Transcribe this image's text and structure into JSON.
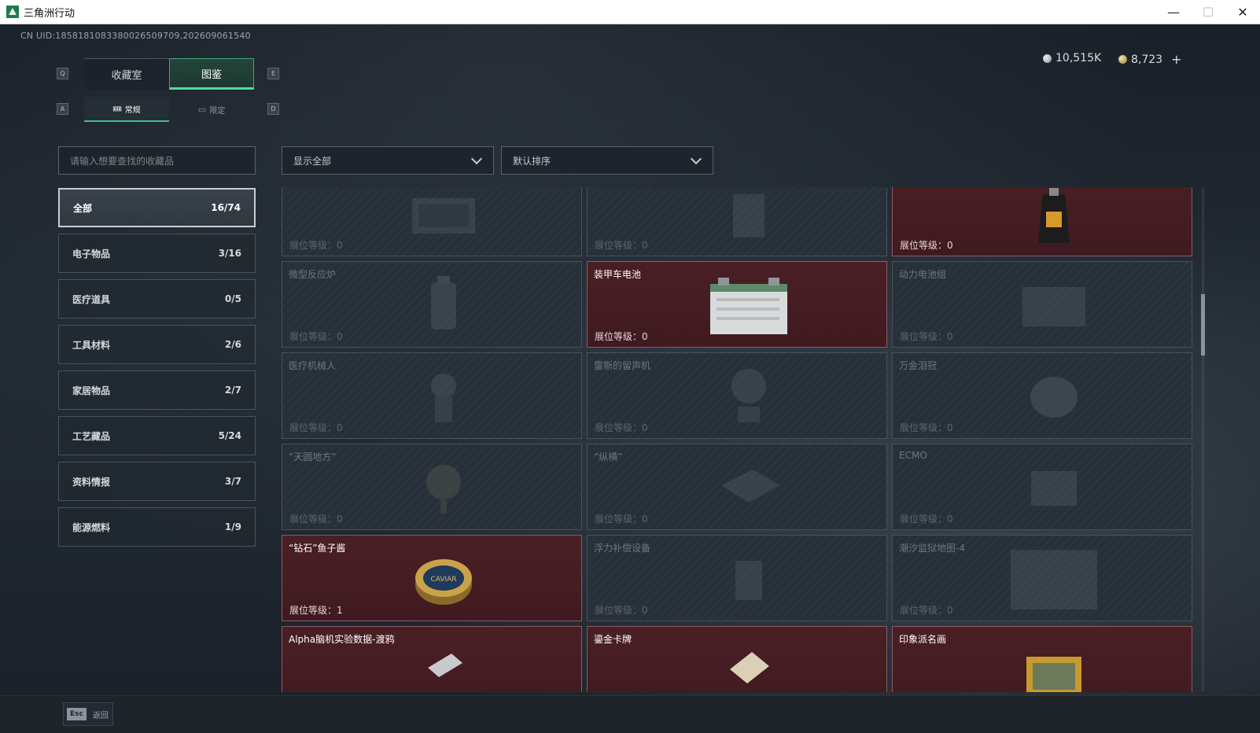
{
  "window": {
    "title": "三角洲行动",
    "minimize": "—",
    "maximize": "☐",
    "close": "✕"
  },
  "uid": "CN UID:1858181083380026509709,202609061540",
  "keys": {
    "q": "Q",
    "e": "E",
    "a": "A",
    "d": "D",
    "esc": "Esc"
  },
  "tabs": [
    {
      "label": "收藏室"
    },
    {
      "label": "图鉴"
    }
  ],
  "subtabs": [
    {
      "label": "常规",
      "icon": "🝚"
    },
    {
      "label": "限定",
      "icon": "▭"
    }
  ],
  "currency": {
    "silver": "10,515K",
    "gold": "8,723",
    "add": "+"
  },
  "search": {
    "placeholder": "请输入想要查找的收藏品"
  },
  "categories": [
    {
      "name": "全部",
      "count": "16/74",
      "active": true
    },
    {
      "name": "电子物品",
      "count": "3/16"
    },
    {
      "name": "医疗道具",
      "count": "0/5"
    },
    {
      "name": "工具材料",
      "count": "2/6"
    },
    {
      "name": "家居物品",
      "count": "2/7"
    },
    {
      "name": "工艺藏品",
      "count": "5/24"
    },
    {
      "name": "资料情报",
      "count": "3/7"
    },
    {
      "name": "能源燃料",
      "count": "1/9"
    }
  ],
  "filters": {
    "show": "显示全部",
    "sort": "默认排序"
  },
  "level_prefix": "展位等级：",
  "cards": [
    {
      "name": "",
      "level": "0",
      "owned": false,
      "icon": "crate"
    },
    {
      "name": "",
      "level": "0",
      "owned": false,
      "icon": "box"
    },
    {
      "name": "",
      "level": "0",
      "owned": true,
      "icon": "bag"
    },
    {
      "name": "微型反应炉",
      "level": "0",
      "owned": false,
      "icon": "reactor"
    },
    {
      "name": "装甲车电池",
      "level": "0",
      "owned": true,
      "icon": "battery"
    },
    {
      "name": "动力电池组",
      "level": "0",
      "owned": false,
      "icon": "pack"
    },
    {
      "name": "医疗机械人",
      "level": "0",
      "owned": false,
      "icon": "robot"
    },
    {
      "name": "雷斯的留声机",
      "level": "0",
      "owned": false,
      "icon": "phonograph"
    },
    {
      "name": "万金泪冠",
      "level": "0",
      "owned": false,
      "icon": "crown"
    },
    {
      "name": "“天圆地方”",
      "level": "0",
      "owned": false,
      "icon": "globe"
    },
    {
      "name": "“纵横”",
      "level": "0",
      "owned": false,
      "icon": "board"
    },
    {
      "name": "ECMO",
      "level": "0",
      "owned": false,
      "icon": "machine"
    },
    {
      "name": "“钻石”鱼子酱",
      "level": "1",
      "owned": true,
      "icon": "caviar",
      "label": "CAVIAR"
    },
    {
      "name": "浮力补偿设备",
      "level": "0",
      "owned": false,
      "icon": "vest"
    },
    {
      "name": "潮汐监狱地图-4",
      "level": "0",
      "owned": false,
      "icon": "map"
    },
    {
      "name": "Alpha脑机实验数据-渡鸦",
      "level": "",
      "owned": true,
      "icon": "disk"
    },
    {
      "name": "鎏金卡牌",
      "level": "",
      "owned": true,
      "icon": "card"
    },
    {
      "name": "印象派名画",
      "level": "",
      "owned": true,
      "icon": "painting"
    }
  ],
  "bottom": {
    "back": "返回"
  }
}
